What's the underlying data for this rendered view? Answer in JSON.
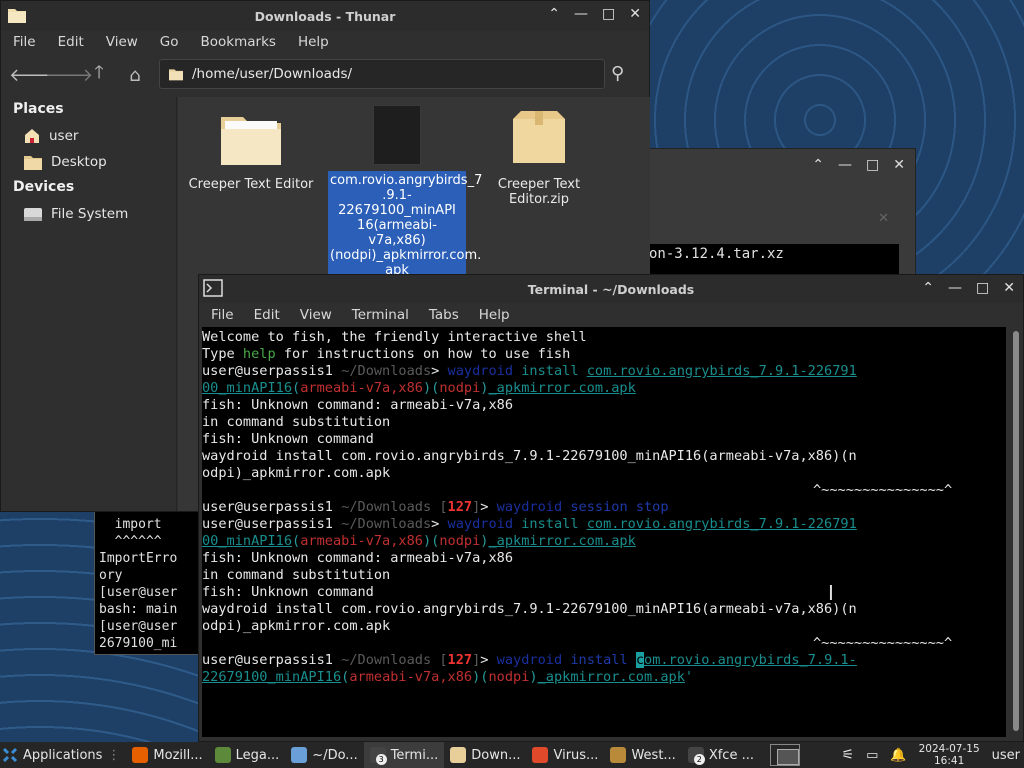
{
  "thunar": {
    "title": "Downloads - Thunar",
    "menu": [
      "File",
      "Edit",
      "View",
      "Go",
      "Bookmarks",
      "Help"
    ],
    "path": "/home/user/Downloads/",
    "sidebar": {
      "places_heading": "Places",
      "places": [
        "user",
        "Desktop"
      ],
      "devices_heading": "Devices",
      "devices": [
        "File System"
      ]
    },
    "files": [
      {
        "name": "Creeper Text Editor",
        "type": "folder"
      },
      {
        "name": "com.rovio.angrybirds_7.9.1-22679100_minAPI16(armeabi-v7a,x86)(nodpi)_apkmirror.com.apk",
        "display": [
          "com.rovio.angrybirds_7",
          ".9.1-22679100_minAPI",
          "16(armeabi-v7a,x86)",
          "(nodpi)_apkmirror.com.",
          "apk"
        ],
        "type": "apk",
        "selected": true
      },
      {
        "name": "Creeper Text Editor.zip",
        "type": "archive"
      }
    ]
  },
  "mid_window": {
    "content": "on-3.12.4.tar.xz"
  },
  "back_terminal": {
    "lines": [
      "  import",
      "  ^^^^^^",
      "ImportErro",
      "ory",
      "[user@user",
      "bash: main",
      "[user@user",
      "2679100_mi"
    ]
  },
  "terminal": {
    "title": "Terminal - ~/Downloads",
    "menu": [
      "File",
      "Edit",
      "View",
      "Terminal",
      "Tabs",
      "Help"
    ],
    "welcome": "Welcome to fish, the friendly interactive shell",
    "help_pre": "Type ",
    "help_word": "help",
    "help_post": " for instructions on how to use fish",
    "prompt_user": "user@userpassis1",
    "prompt_dir": "~/Downloads",
    "status_code": "127",
    "cmd_word": "waydroid",
    "install": "install",
    "session_stop": "session stop",
    "pkg1": "com.rovio.angrybirds_7.9.1-226791",
    "pkg1b": "00_minAPI16",
    "pkg_arch": "armeabi-v7a,x86",
    "pkg_nodpi": "nodpi",
    "pkg_tail": "_apkmirror.com.apk",
    "err1": "fish: Unknown command: armeabi-v7a,x86",
    "err2": "in command substitution",
    "err3": "fish: Unknown command",
    "echo1": "waydroid install com.rovio.angrybirds_7.9.1-22679100_minAPI16(armeabi-v7a,x86)(n",
    "echo2": "odpi)_apkmirror.com.apk",
    "caret": "^~~~~~~~~~~~~~~~^",
    "last_cmd_a": "c",
    "last_cmd_b": "om.rovio.angrybirds_7.9.1-",
    "last_cmd_c": "22679100_minAPI16",
    "last_cmd_end": "'"
  },
  "taskbar": {
    "applications": "Applications",
    "tasks": [
      {
        "label": "Mozill...",
        "icon": "firefox-icon"
      },
      {
        "label": "Lega...",
        "icon": "minecraft-icon"
      },
      {
        "label": "~/Do...",
        "icon": "editor-icon"
      },
      {
        "label": "Termi...",
        "icon": "terminal-icon",
        "badge": "3",
        "active": true
      },
      {
        "label": "Down...",
        "icon": "folder-icon"
      },
      {
        "label": "Virus...",
        "icon": "brave-icon"
      },
      {
        "label": "West...",
        "icon": "game-icon"
      },
      {
        "label": "Xfce ...",
        "icon": "terminal-icon",
        "badge": "2"
      }
    ],
    "date": "2024-07-15",
    "time": "16:41",
    "user": "user"
  }
}
